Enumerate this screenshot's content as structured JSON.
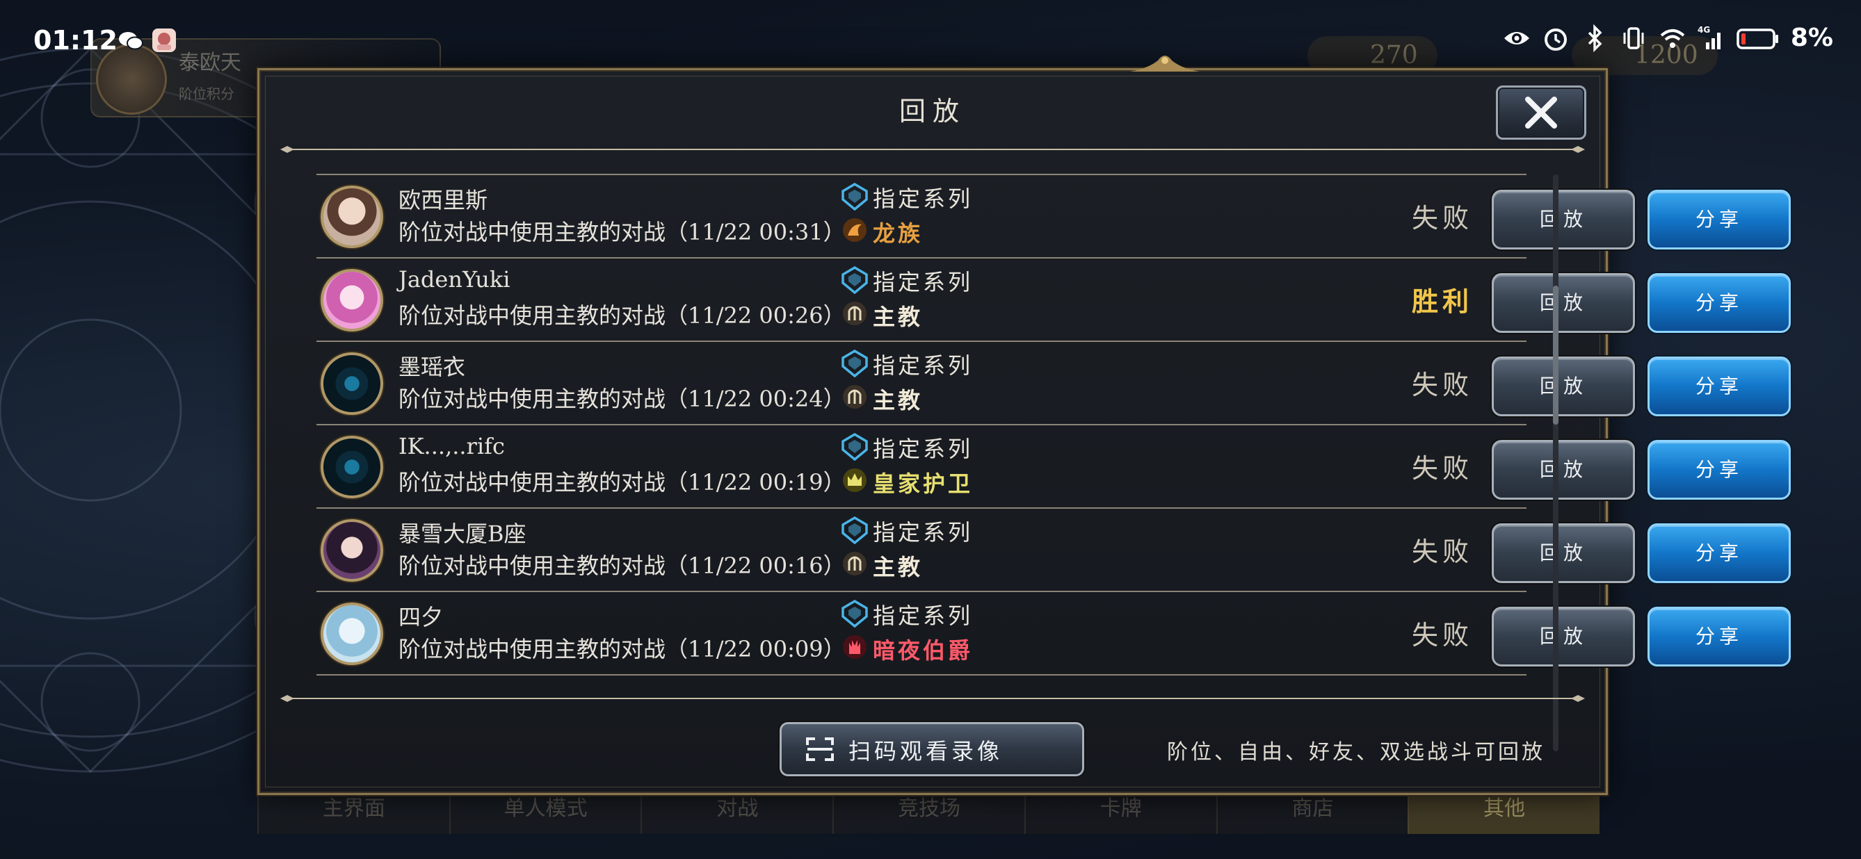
{
  "status_bar": {
    "time": "01:12",
    "battery": "8%",
    "network": "4G",
    "icons": [
      "wechat-icon",
      "game-app-icon",
      "eye-icon",
      "alarm-icon",
      "bluetooth-icon",
      "vibrate-icon",
      "wifi-icon",
      "signal-icon",
      "battery-icon"
    ]
  },
  "background": {
    "player_name": "泰欧天",
    "player_sub": "阶位积分",
    "currency_1": "270",
    "currency_2": "1200",
    "nav": [
      "主界面",
      "单人模式",
      "对战",
      "竞技场",
      "卡牌",
      "商店",
      "其他"
    ]
  },
  "modal": {
    "title": "回放",
    "replay_label": "回放",
    "share_label": "分享",
    "scan_button": "扫码观看录像",
    "footnote": "阶位、自由、好友、双选战斗可回放",
    "rows": [
      {
        "name": "欧西里斯",
        "desc": "阶位对战中使用主教的对战（11/22 00:31）",
        "format": "指定系列",
        "class": "龙族",
        "class_color": "#e8a040",
        "result": "失败",
        "win": false
      },
      {
        "name": "JadenYuki",
        "desc": "阶位对战中使用主教的对战（11/22 00:26）",
        "format": "指定系列",
        "class": "主教",
        "class_color": "#f1ead8",
        "result": "胜利",
        "win": true
      },
      {
        "name": "墨瑶衣",
        "desc": "阶位对战中使用主教的对战（11/22 00:24）",
        "format": "指定系列",
        "class": "主教",
        "class_color": "#f1ead8",
        "result": "失败",
        "win": false
      },
      {
        "name": "IK...,..rifc",
        "desc": "阶位对战中使用主教的对战（11/22 00:19）",
        "format": "指定系列",
        "class": "皇家护卫",
        "class_color": "#e8e070",
        "result": "失败",
        "win": false
      },
      {
        "name": "暴雪大厦B座",
        "desc": "阶位对战中使用主教的对战（11/22 00:16）",
        "format": "指定系列",
        "class": "主教",
        "class_color": "#f1ead8",
        "result": "失败",
        "win": false
      },
      {
        "name": "四夕",
        "desc": "阶位对战中使用主教的对战（11/22 00:09）",
        "format": "指定系列",
        "class": "暗夜伯爵",
        "class_color": "#ff5a6a",
        "result": "失败",
        "win": false
      }
    ]
  }
}
